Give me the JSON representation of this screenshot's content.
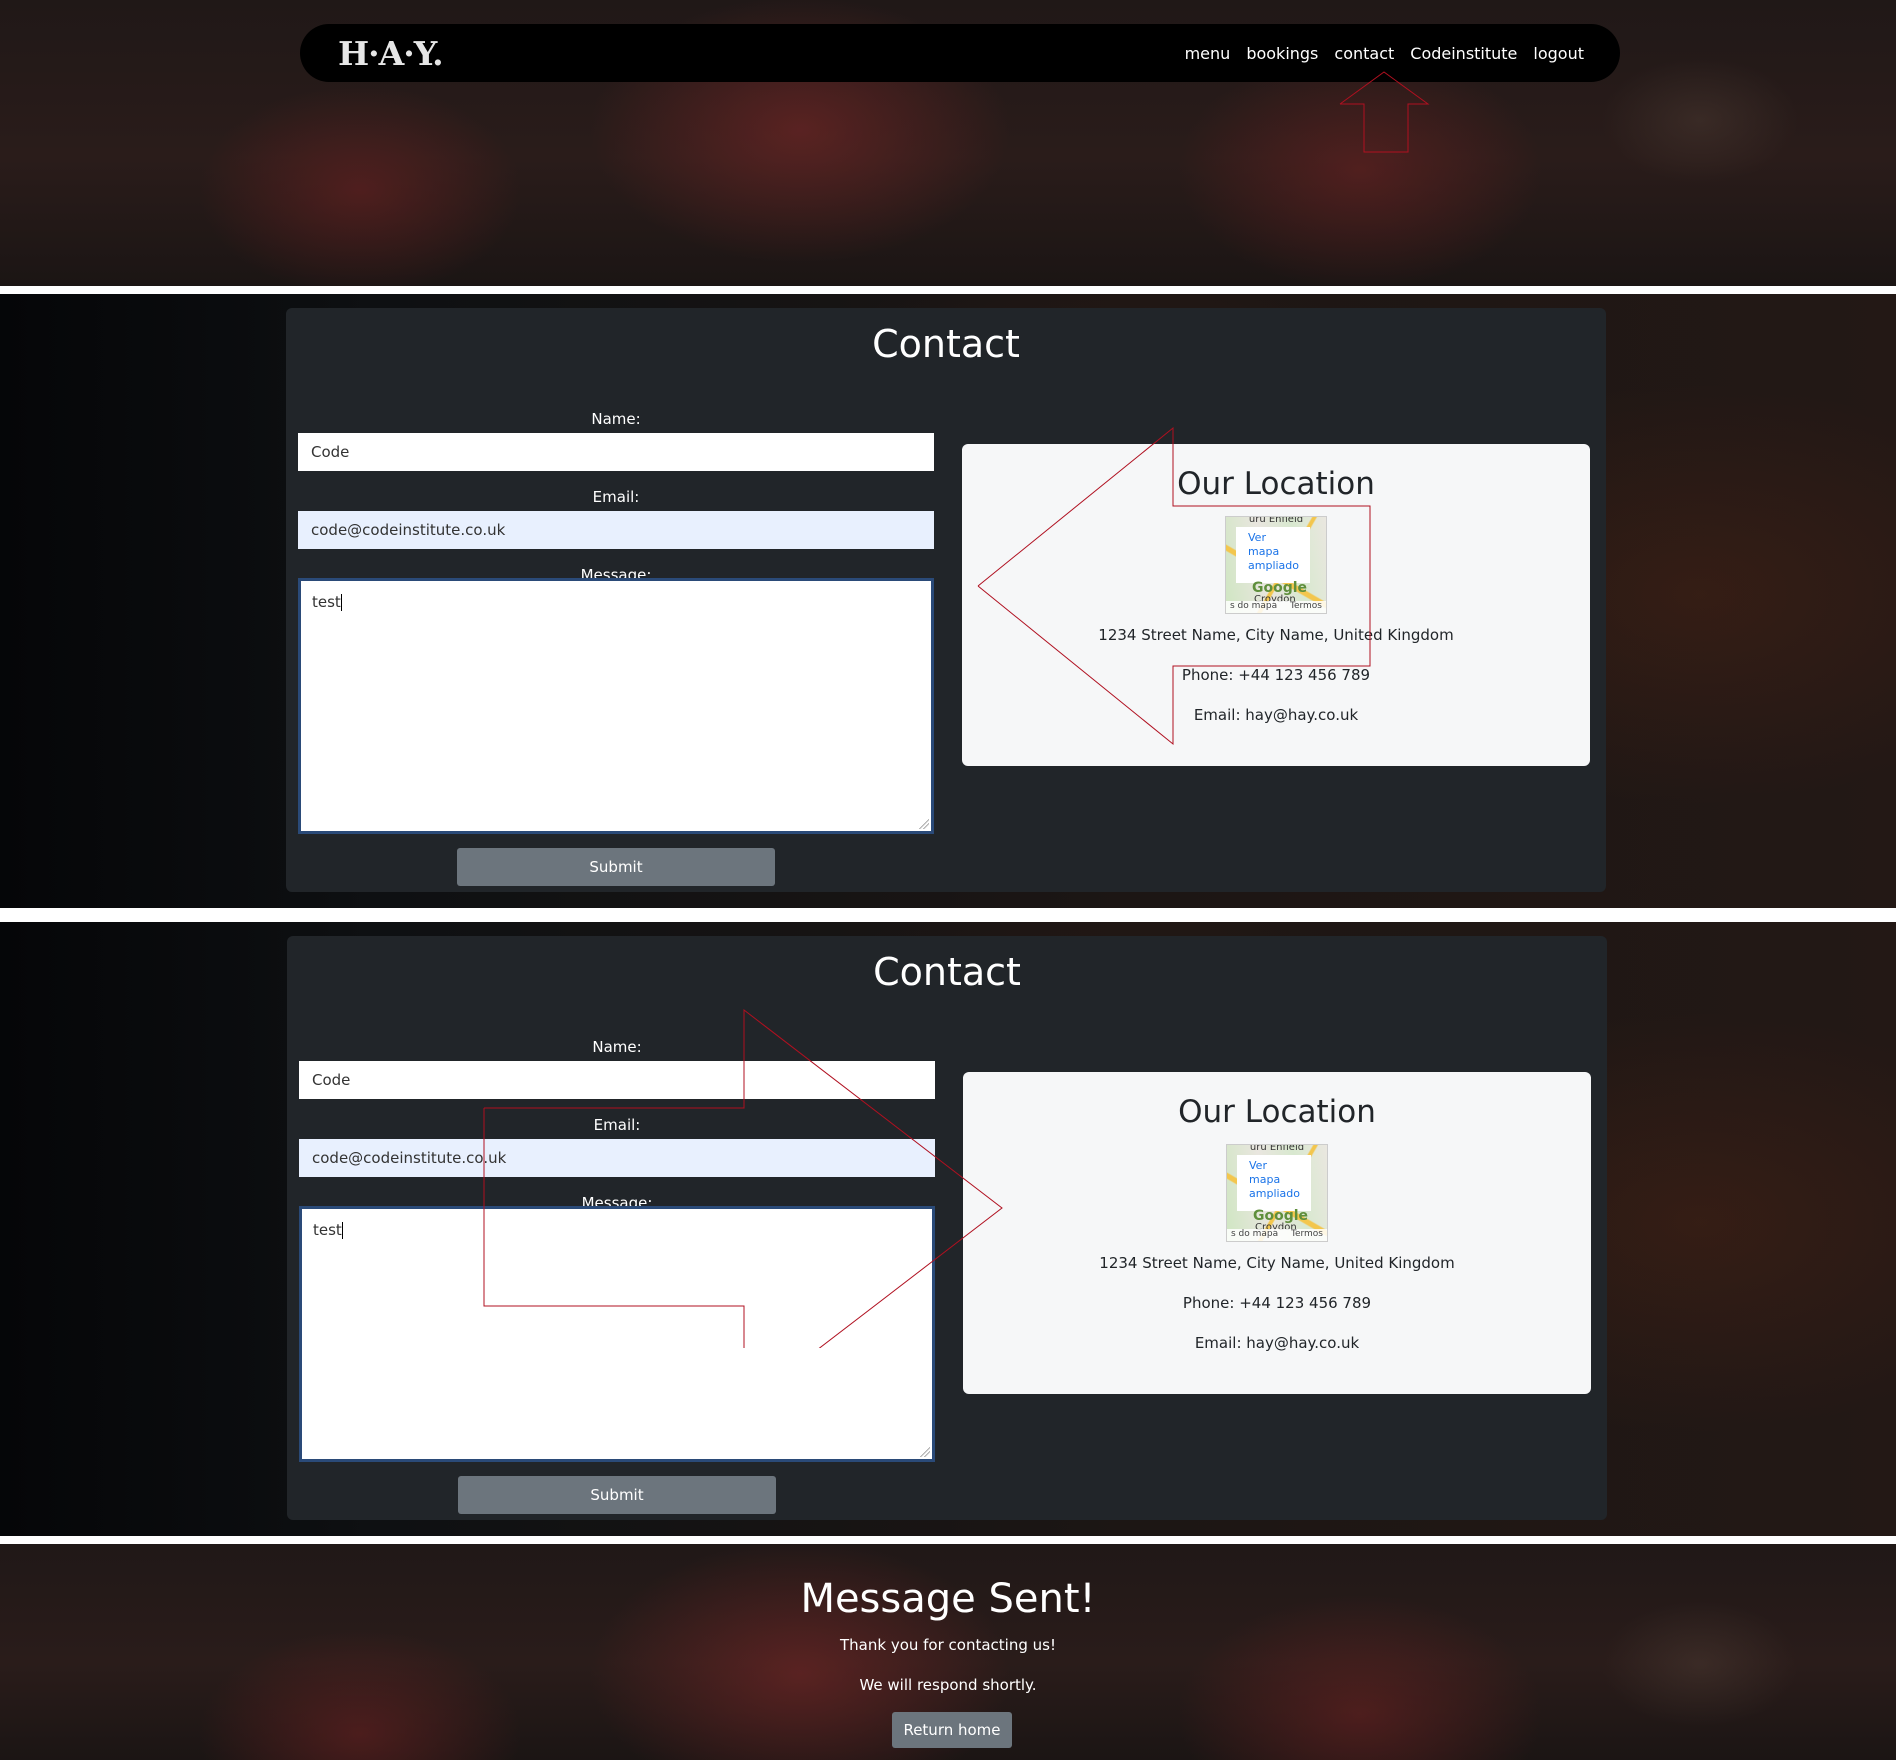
{
  "header": {
    "logo": "H·A·Y.",
    "nav": [
      "menu",
      "bookings",
      "contact",
      "Codeinstitute",
      "logout"
    ]
  },
  "contact": {
    "title": "Contact",
    "name_label": "Name:",
    "name_value": "Code",
    "email_label": "Email:",
    "email_value": "code@codeinstitute.co.uk",
    "message_label": "Message:",
    "message_value": "test",
    "submit_label": "Submit"
  },
  "location": {
    "title": "Our Location",
    "map_top_text": "uru    Enfield",
    "map_link": [
      "Ver",
      "mapa",
      "ampliado"
    ],
    "map_brand": "Google",
    "map_city": "Croydon",
    "map_footer_left": "s do mapa",
    "map_footer_right": "Termos",
    "address": "1234 Street Name, City Name, United Kingdom",
    "phone": "Phone: +44 123 456 789",
    "email": "Email: hay@hay.co.uk"
  },
  "sent": {
    "title": "Message Sent!",
    "line1": "Thank you for contacting us!",
    "line2": "We will respond shortly.",
    "button": "Return home"
  },
  "colors": {
    "card": "#212529",
    "button": "#6c757d",
    "annotation": "#b01020"
  }
}
